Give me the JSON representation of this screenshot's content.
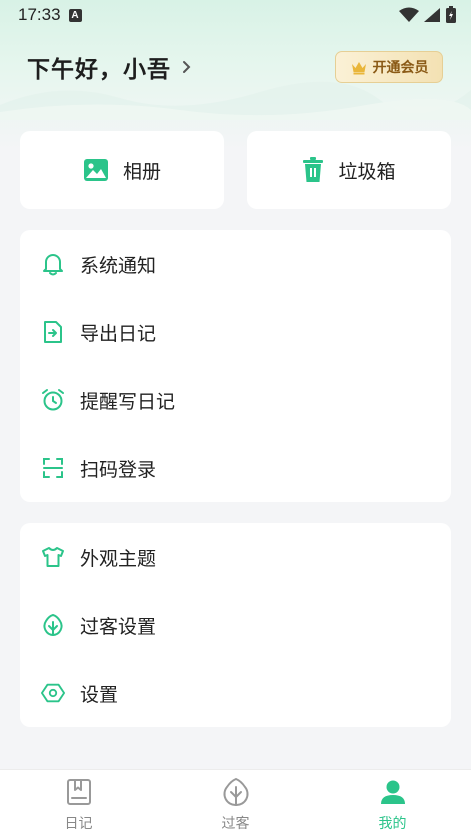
{
  "status_bar": {
    "time": "17:33",
    "badge": "A"
  },
  "header": {
    "greeting": "下午好，小吾",
    "vip_label": "开通会员"
  },
  "quick": [
    {
      "label": "相册",
      "icon": "photo-album-icon"
    },
    {
      "label": "垃圾箱",
      "icon": "trash-icon"
    }
  ],
  "menu_group_1": [
    {
      "label": "系统通知",
      "icon": "bell-icon"
    },
    {
      "label": "导出日记",
      "icon": "export-icon"
    },
    {
      "label": "提醒写日记",
      "icon": "alarm-clock-icon"
    },
    {
      "label": "扫码登录",
      "icon": "scan-icon"
    }
  ],
  "menu_group_2": [
    {
      "label": "外观主题",
      "icon": "tshirt-icon"
    },
    {
      "label": "过客设置",
      "icon": "leaf-icon"
    },
    {
      "label": "设置",
      "icon": "settings-hexagon-icon"
    }
  ],
  "tabbar": [
    {
      "label": "日记",
      "icon": "diary-icon",
      "active": false
    },
    {
      "label": "过客",
      "icon": "leaf-icon",
      "active": false
    },
    {
      "label": "我的",
      "icon": "user-icon",
      "active": true
    }
  ],
  "colors": {
    "accent": "#2bc48a",
    "vip_text": "#8a5a16",
    "background": "#f4f5f7"
  }
}
